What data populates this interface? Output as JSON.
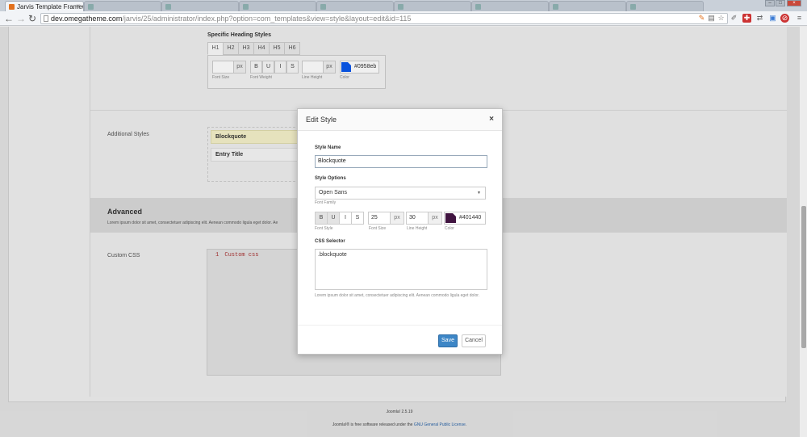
{
  "browser": {
    "active_tab": "Jarvis Template Framewo",
    "other_tabs": [
      "",
      "",
      "",
      "",
      "",
      "",
      "",
      ""
    ],
    "url_host": "dev.omegatheme.com",
    "url_path": "/jarvis/25/administrator/index.php?option=com_templates&view=style&layout=edit&id=115",
    "icons": [
      "back-icon",
      "forward-icon",
      "reload-icon",
      "star-icon",
      "wrench-icon"
    ]
  },
  "heading_styles": {
    "title": "Specific Heading Styles",
    "tabs": [
      "H1",
      "H2",
      "H3",
      "H4",
      "H5",
      "H6"
    ],
    "px": "px",
    "font_size_caption": "Font Size",
    "font_weight_caption": "Font Weight",
    "line_height_caption": "Line Height",
    "color_caption": "Color",
    "format_buttons": [
      "B",
      "U",
      "I",
      "S"
    ],
    "color_value": "#0958eb",
    "color_hex": "#0958eb"
  },
  "additional_styles": {
    "label": "Additional Styles",
    "items": [
      "Blockquote",
      "Entry Title"
    ]
  },
  "advanced": {
    "title": "Advanced",
    "description": "Lorem ipsum dolor sit amet, consectetuer adipiscing elit. Aenean commodo ligula eget dolor. Ae"
  },
  "custom_css": {
    "label": "Custom CSS",
    "line_number": "1",
    "code": "Custom css"
  },
  "footer": {
    "version": "Joomla! 2.5.19",
    "license_prefix": "Joomla!® is free software released under the",
    "license_link": "GNU General Public License",
    "license_suffix": "."
  },
  "modal": {
    "title": "Edit Style",
    "close": "×",
    "style_name_label": "Style Name",
    "style_name_value": "Blockquote",
    "style_options_label": "Style Options",
    "font_family_value": "Open Sans",
    "font_family_caption": "Font Family",
    "format_buttons": [
      "B",
      "U",
      "I",
      "S"
    ],
    "font_style_caption": "Font Style",
    "font_size_value": "25",
    "font_size_caption": "Font Size",
    "line_height_value": "30",
    "line_height_caption": "Line Height",
    "px": "px",
    "color_value": "#401440",
    "color_caption": "Color",
    "color_hex": "#401440",
    "css_selector_label": "CSS Selector",
    "css_selector_value": ".blockquote",
    "help_text": "Lorem ipsum dolor sit amet, consectetuer adipiscing elit. Aenean commodo ligula eget dolor.",
    "save_label": "Save",
    "cancel_label": "Cancel"
  }
}
